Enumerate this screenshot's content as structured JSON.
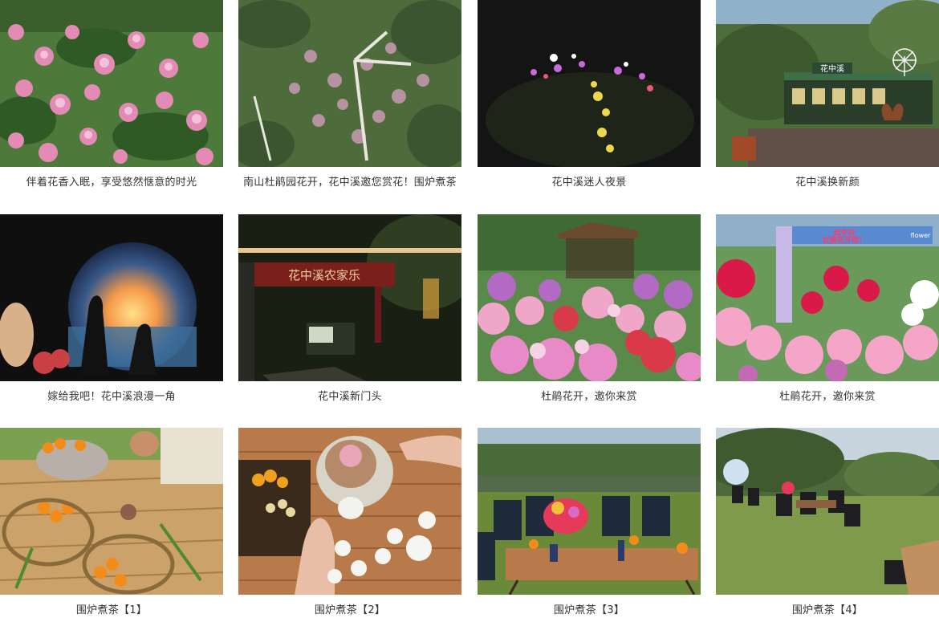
{
  "gallery": {
    "items": [
      {
        "caption": "伴着花香入眠，享受悠然惬意的时光"
      },
      {
        "caption": "南山杜鹃园花开，花中溪邀您赏花！围炉煮茶"
      },
      {
        "caption": "花中溪迷人夜景"
      },
      {
        "caption": "花中溪换新颜"
      },
      {
        "caption": "嫁给我吧！花中溪浪漫一角"
      },
      {
        "caption": "花中溪新门头"
      },
      {
        "caption": "杜鹃花开，邀你来赏"
      },
      {
        "caption": "杜鹃花开，邀你来赏"
      },
      {
        "caption": "围炉煮茶【1】"
      },
      {
        "caption": "围炉煮茶【2】"
      },
      {
        "caption": "围炉煮茶【3】"
      },
      {
        "caption": "围炉煮茶【4】"
      }
    ],
    "photo_signs": {
      "entrance_sign": "花中溪农家乐",
      "festival_banner_line1": "炫牛村",
      "festival_banner_line2": "杜鹃花开啦！",
      "archway_text": "flower",
      "pavilion_sign": "花中溪"
    }
  }
}
